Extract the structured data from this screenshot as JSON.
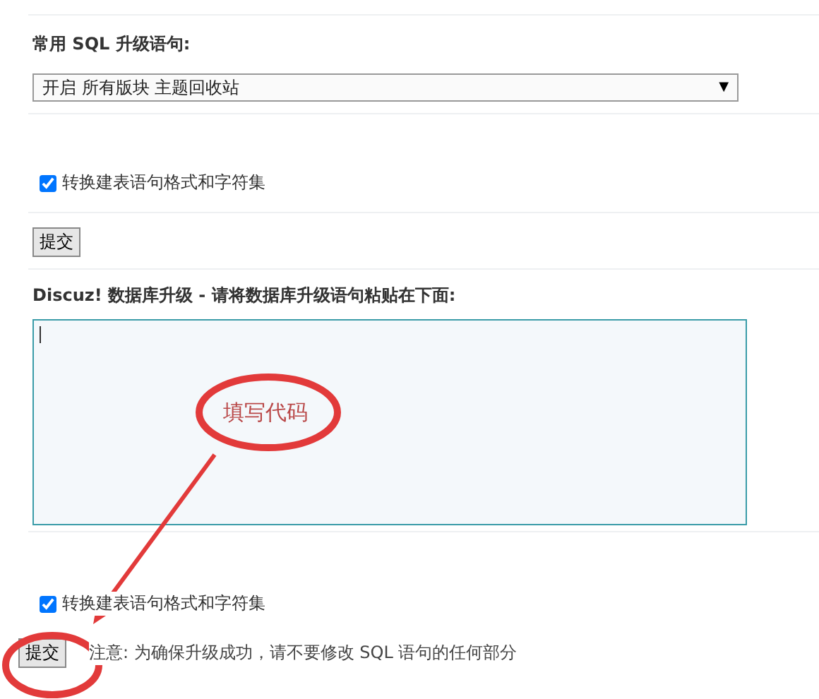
{
  "sql_section": {
    "heading": "常用 SQL 升级语句:",
    "select": {
      "value": "开启 所有版块 主题回收站",
      "caret": "▼"
    },
    "checkbox": {
      "label": "转换建表语句格式和字符集",
      "checked": true
    },
    "submit": "提交"
  },
  "upgrade_section": {
    "heading": "Discuz! 数据库升级 - 请将数据库升级语句粘贴在下面:",
    "checkbox": {
      "label": "转换建表语句格式和字符集",
      "checked": true
    },
    "submit": "提交",
    "note": "注意: 为确保升级成功，请不要修改 SQL 语句的任何部分"
  },
  "annotation": {
    "label": "填写代码"
  }
}
